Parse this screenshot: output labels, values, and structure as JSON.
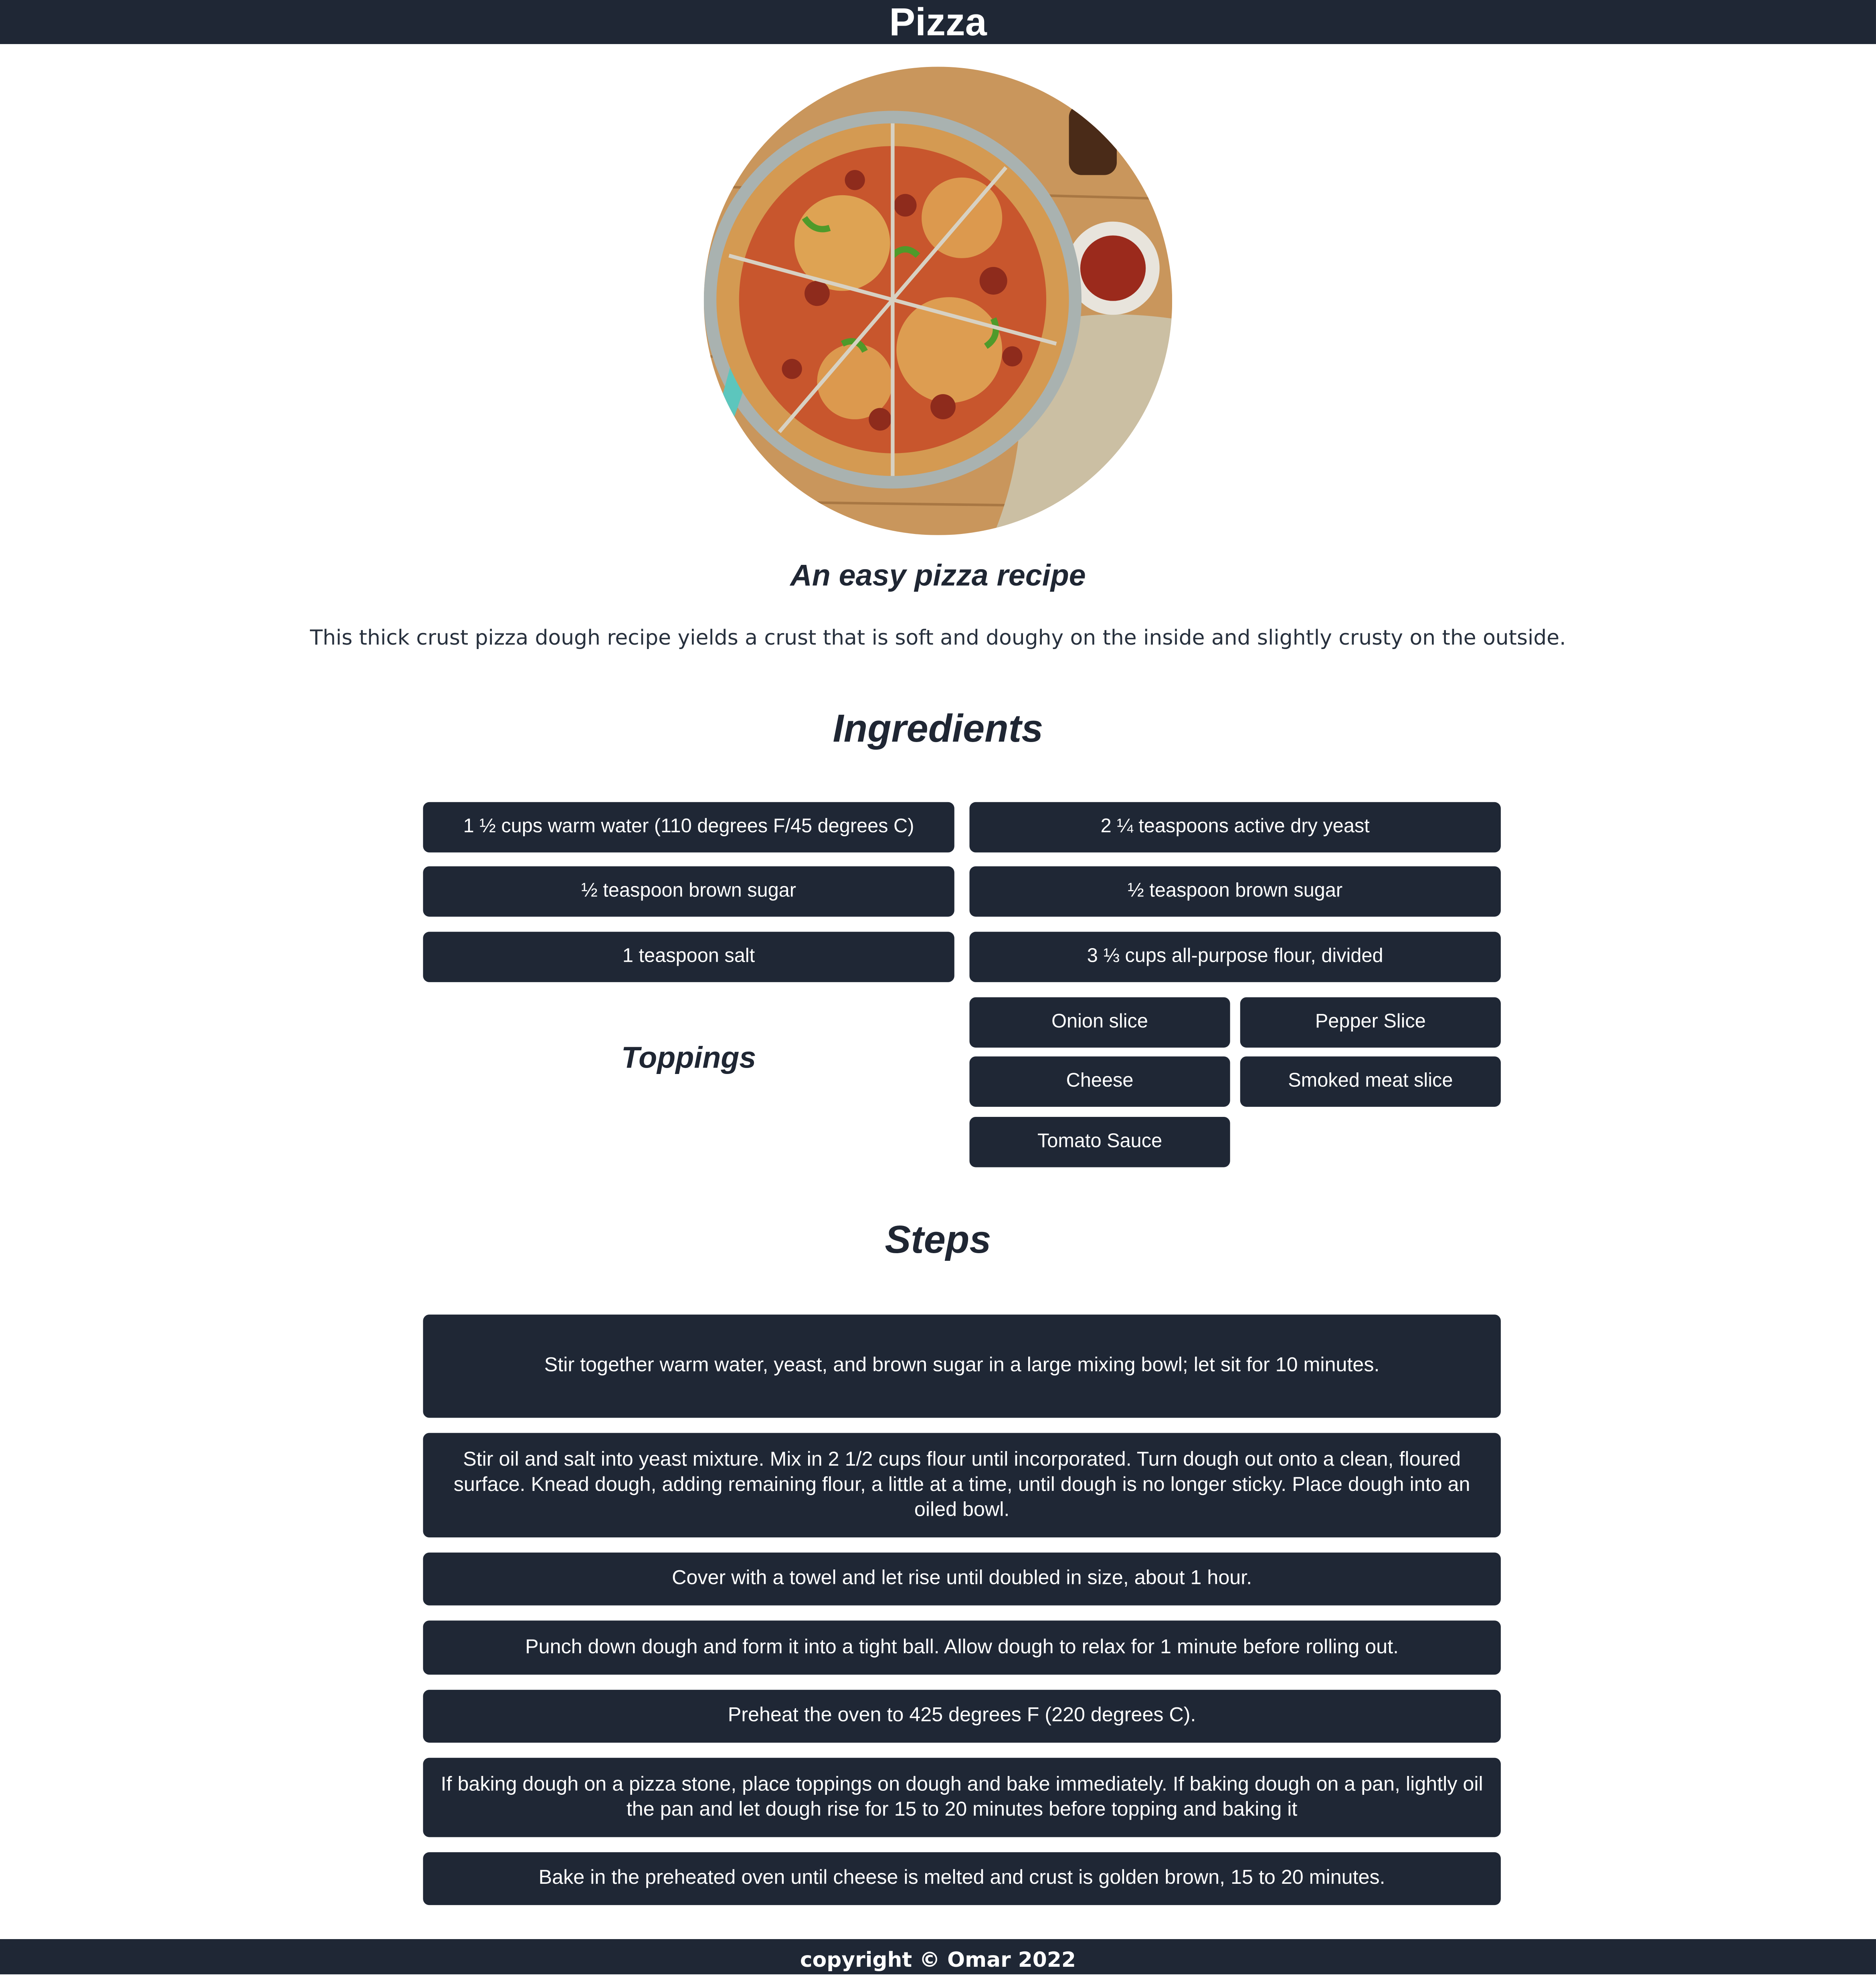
{
  "header": {
    "title": "Pizza"
  },
  "hero": {
    "image_alt": "pizza-photo"
  },
  "subtitle": "An easy pizza recipe",
  "intro": "This thick crust pizza dough recipe yields a crust that is soft and doughy on the inside and slightly crusty on the outside.",
  "ingredients": {
    "title": "Ingredients",
    "items": [
      "1 ½ cups warm water (110 degrees F/45 degrees C)",
      "2 ¼ teaspoons active dry yeast",
      "½ teaspoon brown sugar",
      "½ teaspoon brown sugar",
      "1 teaspoon salt",
      "3 ⅓ cups all-purpose flour, divided"
    ]
  },
  "toppings": {
    "title": "Toppings",
    "items": [
      "Onion slice",
      "Pepper Slice",
      "Cheese",
      "Smoked meat slice",
      "Tomato Sauce"
    ]
  },
  "steps": {
    "title": "Steps",
    "items": [
      "Stir together warm water, yeast, and brown sugar in a large mixing bowl; let sit for 10 minutes.",
      "Stir oil and salt into yeast mixture. Mix in 2 1/2 cups flour until incorporated. Turn dough out onto a clean, floured surface. Knead dough, adding remaining flour, a little at a time, until dough is no longer sticky. Place dough into an oiled bowl.",
      "Cover with a towel and let rise until doubled in size, about 1 hour.",
      "Punch down dough and form it into a tight ball. Allow dough to relax for 1 minute before rolling out.",
      "Preheat the oven to 425 degrees F (220 degrees C).",
      "If baking dough on a pizza stone, place toppings on dough and bake immediately. If baking dough on a pan, lightly oil the pan and let dough rise for 15 to 20 minutes before topping and baking it",
      "Bake in the preheated oven until cheese is melted and crust is golden brown, 15 to 20 minutes."
    ]
  },
  "footer": {
    "text": "copyright © Omar 2022"
  },
  "colors": {
    "dark": "#1f2735",
    "background": "#ffffff"
  }
}
